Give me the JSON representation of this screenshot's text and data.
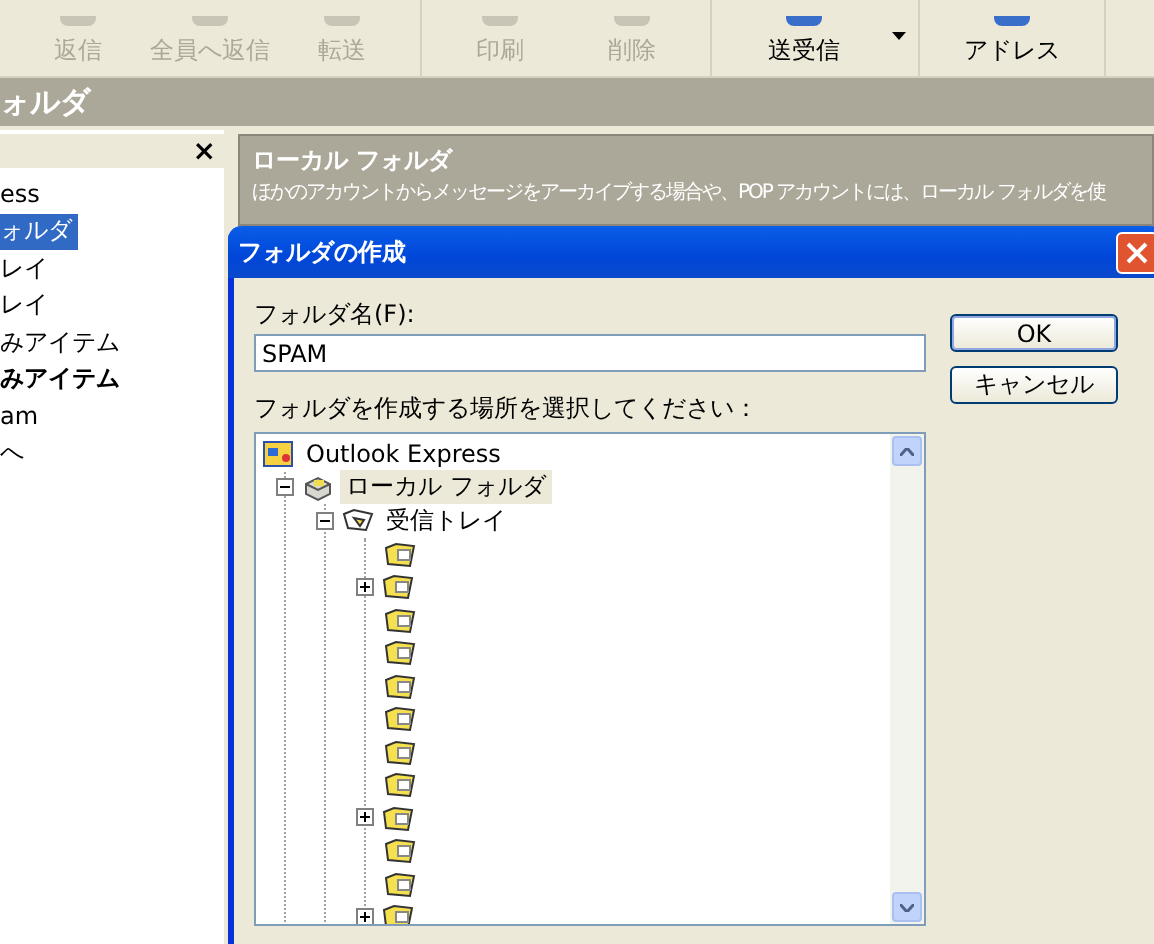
{
  "toolbar": [
    {
      "label": "返信",
      "disabled": true
    },
    {
      "label": "全員へ返信",
      "disabled": true
    },
    {
      "label": "転送",
      "disabled": true
    },
    {
      "label": "印刷",
      "disabled": true
    },
    {
      "label": "削除",
      "disabled": true
    },
    {
      "label": "送受信",
      "disabled": false,
      "dropdown": true
    },
    {
      "label": "アドレス",
      "disabled": false
    }
  ],
  "folder_bar": {
    "title": "ォルダ"
  },
  "folder_pane": {
    "close": "×",
    "items": [
      {
        "label": "ess",
        "selected": false,
        "bold": false
      },
      {
        "label": "ォルダ",
        "selected": true,
        "bold": false
      },
      {
        "label": "レイ",
        "selected": false,
        "bold": false
      },
      {
        "label": "レイ",
        "selected": false,
        "bold": false
      },
      {
        "label": "みアイテム",
        "selected": false,
        "bold": false
      },
      {
        "label": "みアイテム",
        "selected": false,
        "bold": true
      },
      {
        "label": "am",
        "selected": false,
        "bold": false
      },
      {
        "label": "へ",
        "selected": false,
        "bold": false
      }
    ]
  },
  "info_panel": {
    "title": "ローカル フォルダ",
    "description": "ほかのアカウントからメッセージをアーカイブする場合や、POP アカウントには、ローカル フォルダを使"
  },
  "dialog": {
    "title": "フォルダの作成",
    "name_label": "フォルダ名(F):",
    "name_value": "SPAM",
    "location_label": "フォルダを作成する場所を選択してください：",
    "buttons": [
      {
        "label": "OK",
        "default": true
      },
      {
        "label": "キャンセル",
        "default": false
      }
    ],
    "tree": [
      {
        "label": "Outlook Express",
        "kind": "root",
        "selected": false,
        "children": [
          {
            "label": "ローカル フォルダ",
            "kind": "local",
            "selected": true,
            "children": [
              {
                "label": "受信トレイ",
                "kind": "inbox",
                "selected": false,
                "children": [
                  {
                    "kind": "folder",
                    "expandable": false
                  },
                  {
                    "kind": "folder",
                    "expandable": true
                  },
                  {
                    "kind": "folder",
                    "expandable": false
                  },
                  {
                    "kind": "folder",
                    "expandable": false
                  },
                  {
                    "kind": "folder",
                    "expandable": false
                  },
                  {
                    "kind": "folder",
                    "expandable": false
                  },
                  {
                    "kind": "folder",
                    "expandable": false
                  },
                  {
                    "kind": "folder",
                    "expandable": false
                  },
                  {
                    "kind": "folder",
                    "expandable": true
                  },
                  {
                    "kind": "folder",
                    "expandable": false
                  },
                  {
                    "kind": "folder",
                    "expandable": false
                  },
                  {
                    "kind": "folder",
                    "expandable": true
                  }
                ]
              }
            ]
          }
        ]
      }
    ]
  }
}
